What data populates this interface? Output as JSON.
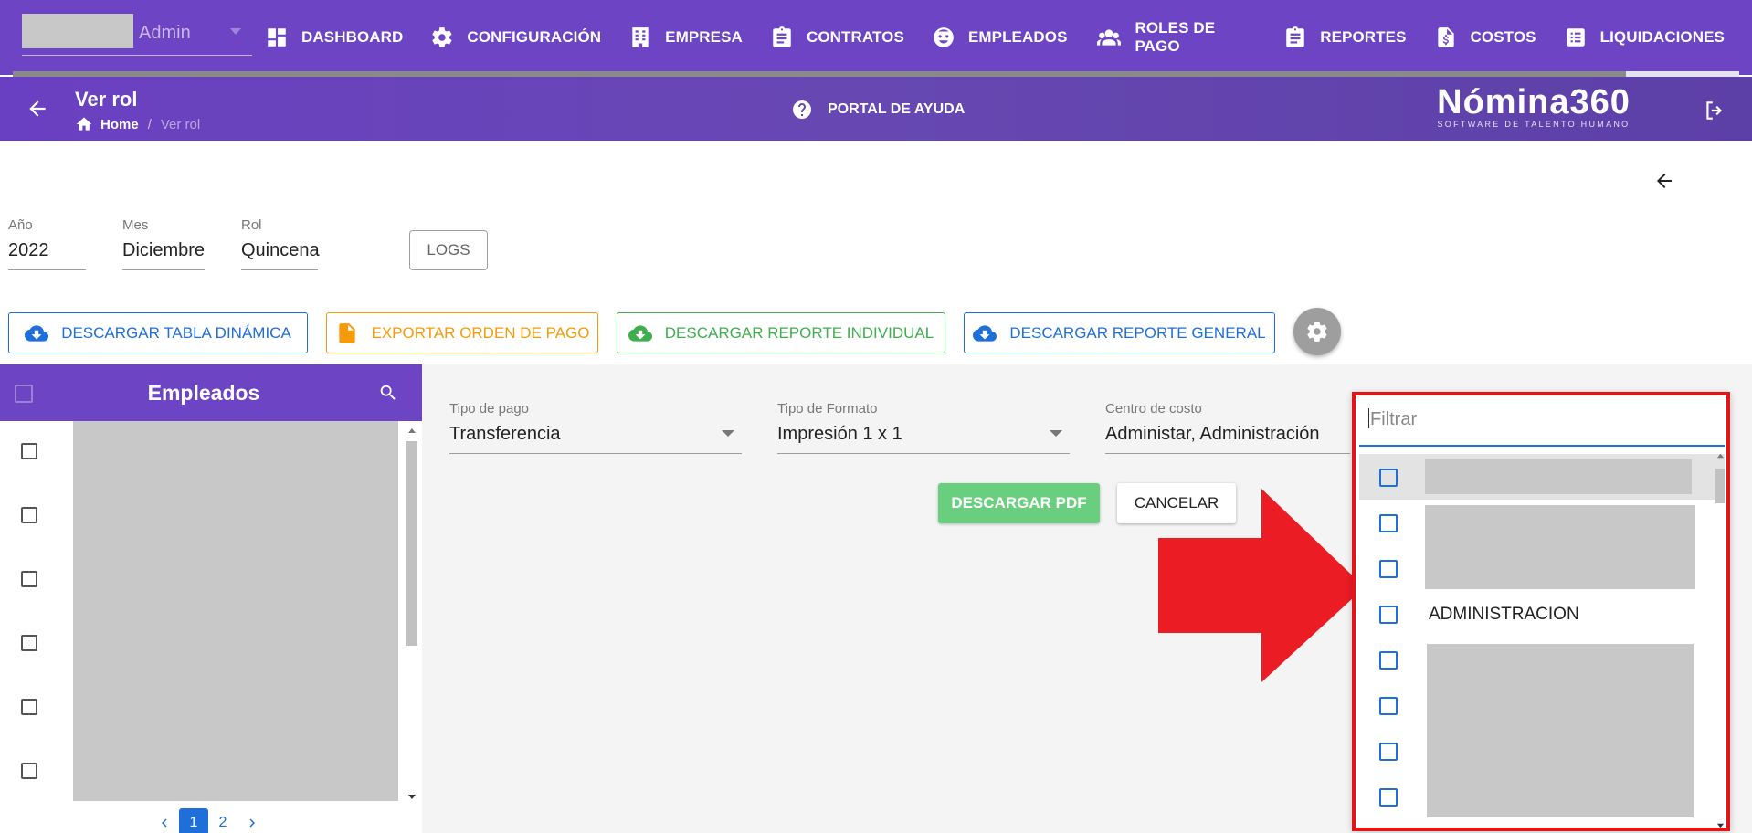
{
  "nav": {
    "user_label": "Admin",
    "items": [
      {
        "label": "DASHBOARD",
        "icon": "dashboard-icon"
      },
      {
        "label": "CONFIGURACIÓN",
        "icon": "gear-icon"
      },
      {
        "label": "EMPRESA",
        "icon": "building-icon"
      },
      {
        "label": "CONTRATOS",
        "icon": "clipboard-icon"
      },
      {
        "label": "EMPLEADOS",
        "icon": "face-icon"
      },
      {
        "label": "ROLES DE PAGO",
        "icon": "people-icon"
      },
      {
        "label": "REPORTES",
        "icon": "clipboard-icon"
      },
      {
        "label": "COSTOS",
        "icon": "invoice-dollar-icon"
      },
      {
        "label": "LIQUIDACIONES",
        "icon": "list-icon"
      }
    ]
  },
  "subheader": {
    "title": "Ver rol",
    "breadcrumb_home": "Home",
    "breadcrumb_separator": "/",
    "breadcrumb_current": "Ver rol",
    "help_label": "PORTAL DE AYUDA",
    "brand_name": "Nómina360",
    "brand_tagline": "SOFTWARE DE TALENTO HUMANO"
  },
  "filters": {
    "year": {
      "label": "Año",
      "value": "2022"
    },
    "month": {
      "label": "Mes",
      "value": "Diciembre"
    },
    "role": {
      "label": "Rol",
      "value": "Quincena"
    },
    "logs_label": "LOGS"
  },
  "actions": [
    {
      "label": "DESCARGAR TABLA DINÁMICA",
      "color": "#1e6fd9",
      "icon": "cloud-download-icon"
    },
    {
      "label": "EXPORTAR ORDEN DE PAGO",
      "color": "#f59b0b",
      "icon": "file-icon"
    },
    {
      "label": "DESCARGAR REPORTE INDIVIDUAL",
      "color": "#3fae4e",
      "icon": "cloud-download-icon"
    },
    {
      "label": "DESCARGAR REPORTE GENERAL",
      "color": "#1e6fd9",
      "icon": "cloud-download-icon"
    }
  ],
  "employees": {
    "title": "Empleados",
    "pages": [
      "1",
      "2"
    ],
    "current_page": "1"
  },
  "form": {
    "payment_type": {
      "label": "Tipo de pago",
      "value": "Transferencia"
    },
    "format_type": {
      "label": "Tipo de Formato",
      "value": "Impresión 1 x 1"
    },
    "cost_center": {
      "label": "Centro de costo",
      "value": "Administar, Administración"
    },
    "download_pdf_label": "DESCARGAR PDF",
    "cancel_label": "CANCELAR"
  },
  "dropdown": {
    "filter_placeholder": "Filtrar",
    "visible_option": "ADMINISTRACION"
  },
  "colors": {
    "primary": "#6c44c4",
    "accent_blue": "#1e6fd9",
    "highlight_red": "#e3141a"
  }
}
